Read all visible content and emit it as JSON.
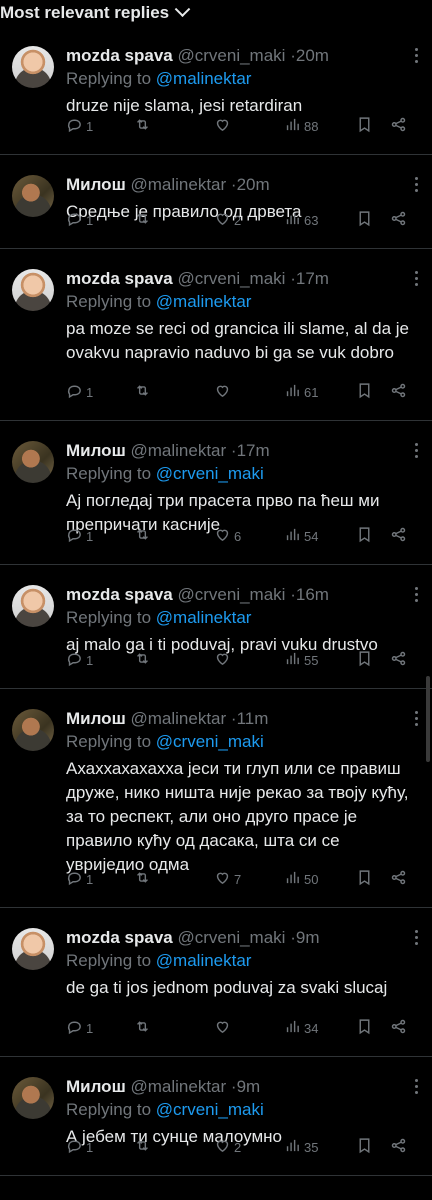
{
  "header": {
    "title": "Most relevant replies"
  },
  "replying_to_label": "Replying to",
  "tweets": [
    {
      "name": "mozda spava",
      "handle": "@crveni_maki",
      "time": "20m",
      "replying_to": "@malinektar",
      "text": "druze nije slama, jesi retardiran",
      "replies": "1",
      "likes": "",
      "views": "88",
      "avatar": "a1"
    },
    {
      "name": "Милош",
      "handle": "@malinektar",
      "time": "20m",
      "replying_to": "",
      "text": "Средње је правило од дрвета",
      "replies": "1",
      "likes": "2",
      "views": "63",
      "avatar": "a2"
    },
    {
      "name": "mozda spava",
      "handle": "@crveni_maki",
      "time": "17m",
      "replying_to": "@malinektar",
      "text": "pa moze se reci od grancica ili slame, al da je ovakvu napravio naduvo bi ga se vuk dobro",
      "replies": "1",
      "likes": "",
      "views": "61",
      "avatar": "a1"
    },
    {
      "name": "Милош",
      "handle": "@malinektar",
      "time": "17m",
      "replying_to": "@crveni_maki",
      "text": "Ај погледај три прасета прво па ћеш ми препричати касније",
      "replies": "1",
      "likes": "6",
      "views": "54",
      "avatar": "a2"
    },
    {
      "name": "mozda spava",
      "handle": "@crveni_maki",
      "time": "16m",
      "replying_to": "@malinektar",
      "text": "aj malo ga i ti poduvaj, pravi vuku drustvo",
      "replies": "1",
      "likes": "",
      "views": "55",
      "avatar": "a1"
    },
    {
      "name": "Милош",
      "handle": "@malinektar",
      "time": "11m",
      "replying_to": "@crveni_maki",
      "text": "Ахаххахахахха јеси ти глуп или се правиш друже, нико ништа није рекао за твоју кућу, за то респект, али оно друго прасе је правило кућу од дасака, шта си се увриједио одма",
      "replies": "1",
      "likes": "7",
      "views": "50",
      "avatar": "a2"
    },
    {
      "name": "mozda spava",
      "handle": "@crveni_maki",
      "time": "9m",
      "replying_to": "@malinektar",
      "text": "de ga ti jos jednom poduvaj za svaki slucaj",
      "replies": "1",
      "likes": "",
      "views": "34",
      "avatar": "a1"
    },
    {
      "name": "Милош",
      "handle": "@malinektar",
      "time": "9m",
      "replying_to": "@crveni_maki",
      "text": "А јебем ти сунце малоумно",
      "replies": "1",
      "likes": "2",
      "views": "35",
      "avatar": "a2"
    }
  ]
}
